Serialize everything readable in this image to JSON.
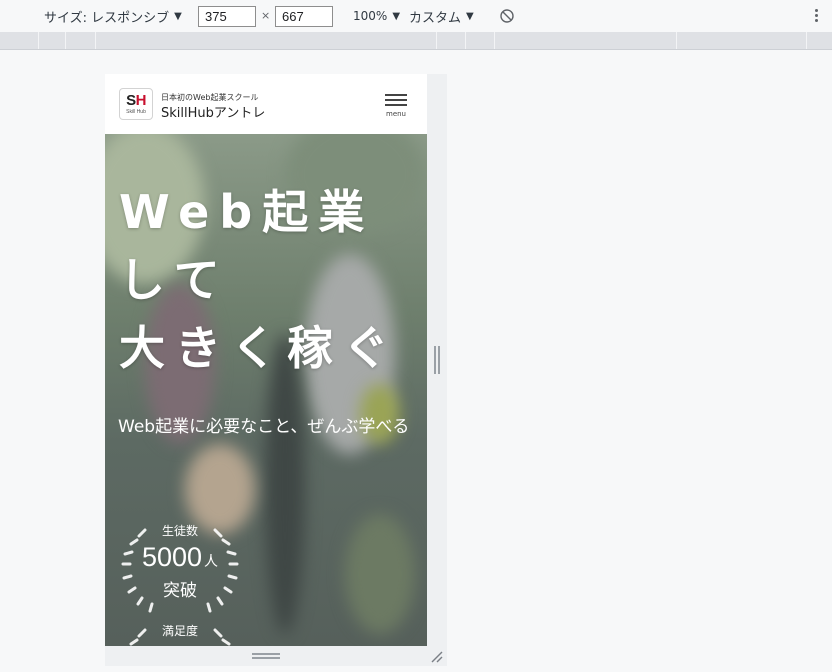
{
  "devtools": {
    "size_label": "サイズ: レスポンシブ",
    "width": "375",
    "times": "×",
    "height": "667",
    "zoom": "100%",
    "throttle": "カスタム"
  },
  "site": {
    "logo_text_s": "S",
    "logo_text_h": "H",
    "logo_small": "Skill Hub",
    "tagline": "日本初のWeb起業スクール",
    "brand": "SkillHubアントレ",
    "menu_label": "menu"
  },
  "hero": {
    "title_lines": [
      "Web起業",
      "して",
      "大きく稼ぐ"
    ],
    "subtitle": "Web起業に必要なこと、ぜんぶ学べる",
    "badge1": {
      "label": "生徒数",
      "number": "5000",
      "unit": "人",
      "sub": "突破"
    },
    "badge2": {
      "label": "満足度"
    }
  },
  "colors": {
    "logo_red": "#c8102e",
    "hero_text": "#ffffff"
  }
}
